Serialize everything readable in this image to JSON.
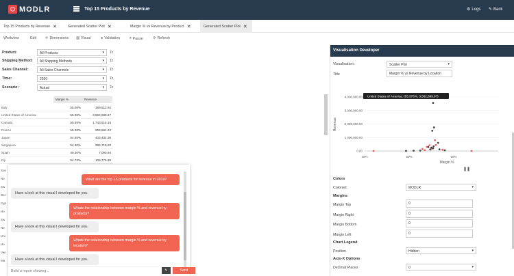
{
  "app": {
    "logo": "MODLR",
    "title": "Top 15 Products by Revenue",
    "logs": "Logs",
    "back": "Back"
  },
  "tabs": [
    {
      "label": "Top 15 Products by Revenue"
    },
    {
      "label": "Generated Scatter Plot"
    },
    {
      "label": "Margin % vs Revenue by Product"
    },
    {
      "label": "Generated Scatter Plot"
    }
  ],
  "toolbar": {
    "workview": "Workview",
    "edit": "Edit",
    "dimensions": "Dimensions",
    "visual": "Visual",
    "validation": "Validation",
    "pause": "Pause",
    "refresh": "Refresh"
  },
  "filters": [
    {
      "label": "Product:",
      "value": "All Products"
    },
    {
      "label": "Shipping Method:",
      "value": "All Shipping Methods"
    },
    {
      "label": "Sales Channel:",
      "value": "All Sales Channels"
    },
    {
      "label": "Time:",
      "value": "2020"
    },
    {
      "label": "Scenario:",
      "value": "Actual"
    }
  ],
  "grid": {
    "headers": [
      "Margin %",
      "Revenue"
    ],
    "rows": [
      {
        "name": "Italy",
        "margin": "55.08%",
        "revenue": "169,512.54"
      },
      {
        "name": "United States of America",
        "margin": "55.38%",
        "revenue": "3,562,699.67"
      },
      {
        "name": "Canada",
        "margin": "55.59%",
        "revenue": "1,743,515.15"
      },
      {
        "name": "France",
        "margin": "55.38%",
        "revenue": "203,681.23"
      },
      {
        "name": "Japan",
        "margin": "54.55%",
        "revenue": "423,432.38"
      },
      {
        "name": "Singapore",
        "margin": "54.30%",
        "revenue": "289,719.03"
      },
      {
        "name": "Spain",
        "margin": "49.30%",
        "revenue": "7,093.94"
      },
      {
        "name": "Fiji",
        "margin": "54.73%",
        "revenue": "109,776.89"
      }
    ],
    "row_stubs": [
      "Sou",
      "Ne",
      "Sw",
      "Ger",
      "Cyp",
      "Ho",
      "Sw",
      "Ne",
      "Uni",
      "Ho",
      "Ven",
      "Ma"
    ]
  },
  "chat": {
    "messages": [
      {
        "role": "user",
        "text": "What are the top 15 products for revenue in 2019?"
      },
      {
        "role": "bot",
        "text": "Have a look at this visual I developed for you."
      },
      {
        "role": "user",
        "text": "Whats the relationship between margin % and revenue by products?"
      },
      {
        "role": "bot",
        "text": "Have a look at this visual I developed for you."
      },
      {
        "role": "user",
        "text": "Whats the relationship between margin % and revenue by location?"
      },
      {
        "role": "bot",
        "text": "Have a look at this visual I developed for you."
      }
    ],
    "placeholder": "Build a report showing...",
    "send": "Send"
  },
  "vd": {
    "title": "Visualisation Developer",
    "visualisation_label": "Visualisation:",
    "visualisation_value": "Scatter Plot",
    "title_label": "Title",
    "title_value": "Margin % vs Revenue by Location",
    "colors_section": "Colors",
    "colorset_label": "Colorset",
    "colorset_value": "MODLR",
    "margins_section": "Margins",
    "margin_top_label": "Margin Top",
    "margin_top": "0",
    "margin_right_label": "Margin Right",
    "margin_right": "0",
    "margin_bottom_label": "Margin Bottom",
    "margin_bottom": "0",
    "margin_left_label": "Margin Left",
    "margin_left": "0",
    "legend_section": "Chart Legend",
    "position_label": "Position",
    "position_value": "Hidden",
    "axisx_section": "Axis-X Options",
    "decimal_label": "Decimal Places",
    "decimal_value": "0"
  },
  "chart_data": {
    "type": "scatter",
    "xlabel": "Margin %",
    "ylabel": "Revenue",
    "xlim": [
      40,
      70
    ],
    "ylim": [
      0,
      4000000
    ],
    "x_ticks": [
      "40%",
      "50%",
      "60%"
    ],
    "y_ticks": [
      "4,000,000.00",
      "3,000,000.00",
      "2,000,000.00",
      "1,000,000.00",
      "0.00"
    ],
    "tooltip": "United States of America: (55.376%, 3,562,699.67)",
    "points": [
      {
        "x": 55.38,
        "y": 3562699.67,
        "c": "#222"
      },
      {
        "x": 55.59,
        "y": 1743515.15,
        "c": "#222"
      },
      {
        "x": 55.2,
        "y": 1500000,
        "c": "#222"
      },
      {
        "x": 55.08,
        "y": 169512.54,
        "c": "#e8474a"
      },
      {
        "x": 55.38,
        "y": 203681.23,
        "c": "#222"
      },
      {
        "x": 54.55,
        "y": 423432.38,
        "c": "#e8474a"
      },
      {
        "x": 54.3,
        "y": 289719.03,
        "c": "#222"
      },
      {
        "x": 49.3,
        "y": 7093.94,
        "c": "#222"
      },
      {
        "x": 54.73,
        "y": 109776.89,
        "c": "#222"
      },
      {
        "x": 56.5,
        "y": 600000,
        "c": "#222"
      },
      {
        "x": 56.0,
        "y": 450000,
        "c": "#e8474a"
      },
      {
        "x": 53.5,
        "y": 60000,
        "c": "#e8474a"
      },
      {
        "x": 52.5,
        "y": 30000,
        "c": "#222"
      },
      {
        "x": 51.0,
        "y": 20000,
        "c": "#222"
      },
      {
        "x": 57.5,
        "y": 100000,
        "c": "#e8474a"
      },
      {
        "x": 58.0,
        "y": 50000,
        "c": "#222"
      },
      {
        "x": 55.8,
        "y": 800000,
        "c": "#e8474a"
      },
      {
        "x": 55.0,
        "y": 250000,
        "c": "#222"
      },
      {
        "x": 53.0,
        "y": 150000,
        "c": "#e8474a"
      },
      {
        "x": 56.8,
        "y": 120000,
        "c": "#222"
      },
      {
        "x": 42.0,
        "y": 0,
        "c": "#e8474a"
      },
      {
        "x": 64.0,
        "y": 0,
        "c": "#e8474a"
      },
      {
        "x": 54.0,
        "y": 300000,
        "c": "#e8474a"
      },
      {
        "x": 55.5,
        "y": 350000,
        "c": "#222"
      }
    ],
    "colors": {
      "dark": "#222222",
      "accent": "#e8474a",
      "axis": "#999999"
    }
  }
}
